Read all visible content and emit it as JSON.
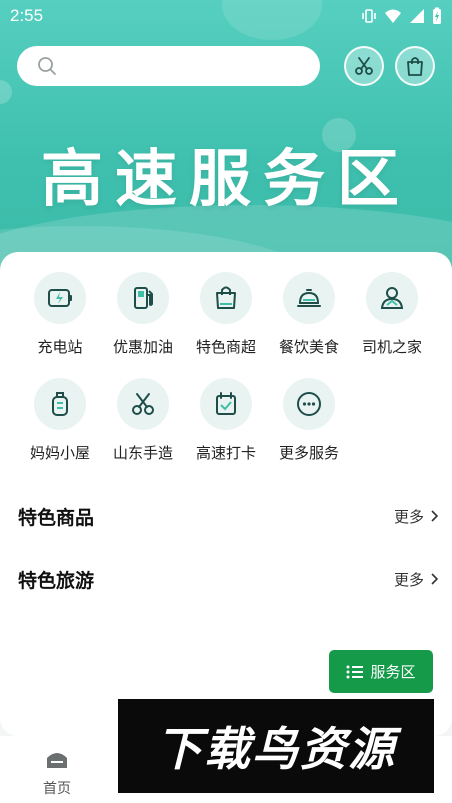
{
  "status_bar": {
    "time": "2:55",
    "icons": [
      "vibrate-icon",
      "wifi-icon",
      "cellular-icon",
      "battery-charging-icon"
    ]
  },
  "header": {
    "search_placeholder": "",
    "buttons": [
      {
        "name": "scissors-button",
        "icon": "scissors-icon"
      },
      {
        "name": "shopping-bag-button",
        "icon": "shopping-bag-icon"
      }
    ]
  },
  "banner": {
    "title": "高速服务区"
  },
  "services": [
    {
      "label": "充电站",
      "icon": "charging-icon"
    },
    {
      "label": "优惠加油",
      "icon": "fuel-pump-icon"
    },
    {
      "label": "特色商超",
      "icon": "shopping-bag-icon"
    },
    {
      "label": "餐饮美食",
      "icon": "service-bell-icon"
    },
    {
      "label": "司机之家",
      "icon": "driver-icon"
    },
    {
      "label": "妈妈小屋",
      "icon": "baby-bottle-icon"
    },
    {
      "label": "山东手造",
      "icon": "scissors-icon"
    },
    {
      "label": "高速打卡",
      "icon": "calendar-check-icon"
    },
    {
      "label": "更多服务",
      "icon": "more-icon"
    }
  ],
  "sections": [
    {
      "title": "特色商品",
      "more": "更多"
    },
    {
      "title": "特色旅游",
      "more": "更多"
    }
  ],
  "float_button": {
    "label": "服务区",
    "icon": "list-icon"
  },
  "tabbar": {
    "home_label": "首页",
    "home_icon": "home-icon"
  },
  "watermark": {
    "text": "下载鸟资源"
  },
  "colors": {
    "hero_gradient_top": "#56cfc0",
    "hero_gradient_bottom": "#3bb9a7",
    "icon_stroke": "#1f4e4a",
    "icon_circle_bg": "#e9f4f2",
    "float_button_bg": "#159a4a",
    "watermark_bg": "#0a0a0a"
  }
}
